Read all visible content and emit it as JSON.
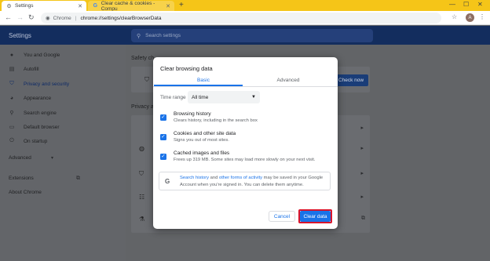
{
  "browser": {
    "tabs": [
      {
        "label": "Settings",
        "icon": "gear-icon"
      },
      {
        "label": "Clear cache & cookies - Compu",
        "icon": "google-icon"
      }
    ],
    "omnibox": {
      "site": "Chrome",
      "url": "chrome://settings/clearBrowserData"
    },
    "profile_initial": "A"
  },
  "settings": {
    "title": "Settings",
    "search_placeholder": "Search settings",
    "sidebar": [
      {
        "label": "You and Google",
        "icon": "person-icon"
      },
      {
        "label": "Autofill",
        "icon": "autofill-icon"
      },
      {
        "label": "Privacy and security",
        "icon": "shield-icon",
        "active": true
      },
      {
        "label": "Appearance",
        "icon": "palette-icon"
      },
      {
        "label": "Search engine",
        "icon": "search-icon"
      },
      {
        "label": "Default browser",
        "icon": "browser-icon"
      },
      {
        "label": "On startup",
        "icon": "power-icon"
      }
    ],
    "advanced": "Advanced",
    "extensions": "Extensions",
    "about": "About Chrome",
    "safety_check_label": "Safety ch",
    "privacy_label": "Privacy a",
    "check_now": "Check now"
  },
  "dialog": {
    "title": "Clear browsing data",
    "tabs": [
      "Basic",
      "Advanced"
    ],
    "time_range_label": "Time range",
    "time_range_value": "All time",
    "options": [
      {
        "title": "Browsing history",
        "subtitle": "Clears history, including in the search box",
        "checked": true
      },
      {
        "title": "Cookies and other site data",
        "subtitle": "Signs you out of most sites.",
        "checked": true
      },
      {
        "title": "Cached images and files",
        "subtitle": "Frees up 319 MB. Some sites may load more slowly on your next visit.",
        "checked": true
      }
    ],
    "google_notice": {
      "link1": "Search history",
      "and": " and ",
      "link2": "other forms of activity",
      "rest1": " may be saved in your Google",
      "line2": "Account when you're signed in. You can delete them anytime."
    },
    "cancel": "Cancel",
    "clear": "Clear data"
  },
  "colors": {
    "accent": "#1a73e8",
    "tab_strip": "#f5c518",
    "settings_header": "#132d5e",
    "highlight_outline": "#d9142b"
  }
}
